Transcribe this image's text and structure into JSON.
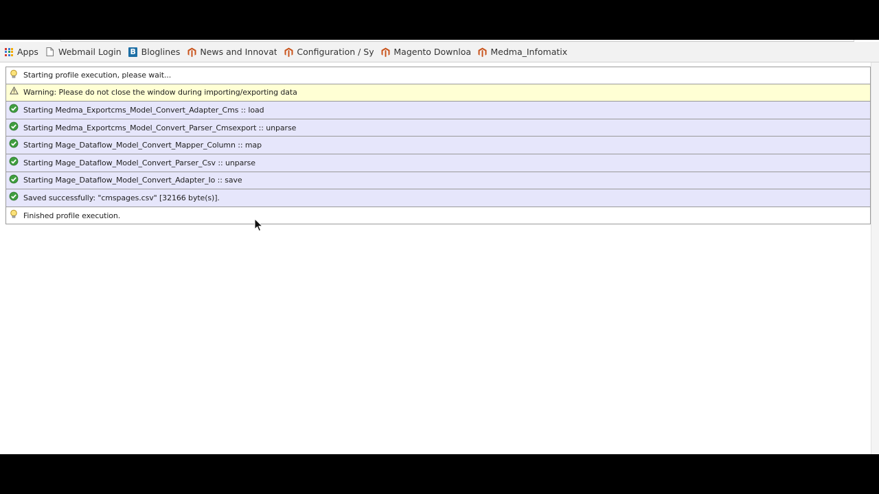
{
  "bookmarks": [
    {
      "label": "Apps",
      "icon": "apps-grid-icon"
    },
    {
      "label": "Webmail Login",
      "icon": "page-icon"
    },
    {
      "label": "Bloglines",
      "icon": "bloglines-icon"
    },
    {
      "label": "News and Innovati",
      "icon": "magento-icon"
    },
    {
      "label": "Configuration / Sys",
      "icon": "magento-icon"
    },
    {
      "label": "Magento Downloa",
      "icon": "magento-icon"
    },
    {
      "label": "Medma_Infomatix",
      "icon": "magento-icon"
    }
  ],
  "log": [
    {
      "type": "info",
      "icon": "lightbulb-icon",
      "text": "Starting profile execution, please wait..."
    },
    {
      "type": "warn",
      "icon": "warning-icon",
      "text": "Warning: Please do not close the window during importing/exporting data"
    },
    {
      "type": "ok",
      "icon": "check-icon",
      "text": "Starting Medma_Exportcms_Model_Convert_Adapter_Cms :: load"
    },
    {
      "type": "ok",
      "icon": "check-icon",
      "text": "Starting Medma_Exportcms_Model_Convert_Parser_Cmsexport :: unparse"
    },
    {
      "type": "ok",
      "icon": "check-icon",
      "text": "Starting Mage_Dataflow_Model_Convert_Mapper_Column :: map"
    },
    {
      "type": "ok",
      "icon": "check-icon",
      "text": "Starting Mage_Dataflow_Model_Convert_Parser_Csv :: unparse"
    },
    {
      "type": "ok",
      "icon": "check-icon",
      "text": "Starting Mage_Dataflow_Model_Convert_Adapter_Io :: save"
    },
    {
      "type": "ok",
      "icon": "check-icon",
      "text": "Saved successfully: \"cmspages.csv\" [32166 byte(s)]."
    },
    {
      "type": "info",
      "icon": "lightbulb-icon",
      "text": "Finished profile execution."
    }
  ],
  "colors": {
    "info_bg": "#ffffff",
    "warn_bg": "#ffffd4",
    "ok_bg": "#e6e6fb",
    "check_green": "#3f9e3f",
    "magento_orange": "#c9541c"
  }
}
